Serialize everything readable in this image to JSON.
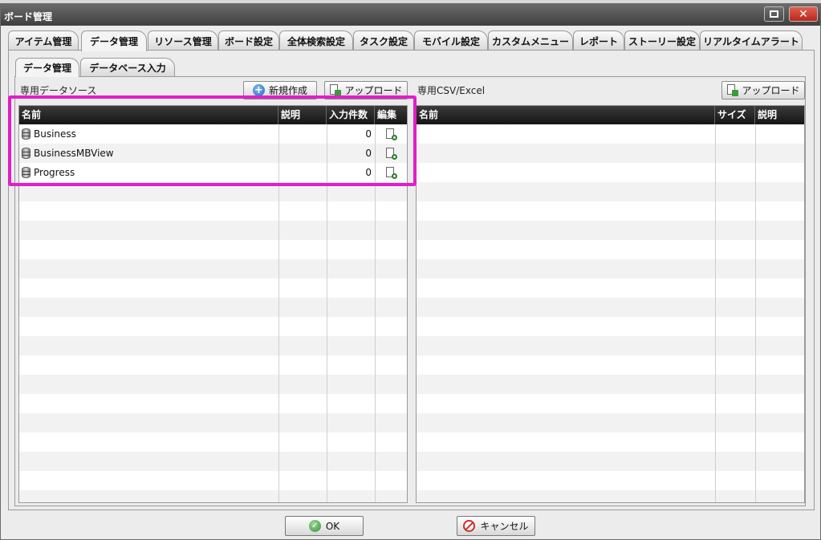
{
  "window": {
    "title": "ボード管理"
  },
  "top_tabs": [
    {
      "label": "アイテム管理"
    },
    {
      "label": "データ管理"
    },
    {
      "label": "リソース管理"
    },
    {
      "label": "ボード設定"
    },
    {
      "label": "全体検索設定"
    },
    {
      "label": "タスク設定"
    },
    {
      "label": "モバイル設定"
    },
    {
      "label": "カスタムメニュー"
    },
    {
      "label": "レポート"
    },
    {
      "label": "ストーリー設定"
    },
    {
      "label": "リアルタイムアラート"
    }
  ],
  "sub_tabs": [
    {
      "label": "データ管理"
    },
    {
      "label": "データベース入力"
    }
  ],
  "datasource": {
    "section_label": "専用データソース",
    "new_button": "新規作成",
    "upload_button": "アップロード",
    "columns": [
      "名前",
      "説明",
      "入力件数",
      "編集"
    ],
    "rows": [
      {
        "name": "Business",
        "desc": "",
        "count": "0"
      },
      {
        "name": "BusinessMBView",
        "desc": "",
        "count": "0"
      },
      {
        "name": "Progress",
        "desc": "",
        "count": "0"
      }
    ]
  },
  "files": {
    "section_label": "専用CSV/Excel",
    "upload_button": "アップロード",
    "columns": [
      "名前",
      "サイズ",
      "説明"
    ]
  },
  "footer": {
    "ok_label": "OK",
    "cancel_label": "キャンセル"
  }
}
